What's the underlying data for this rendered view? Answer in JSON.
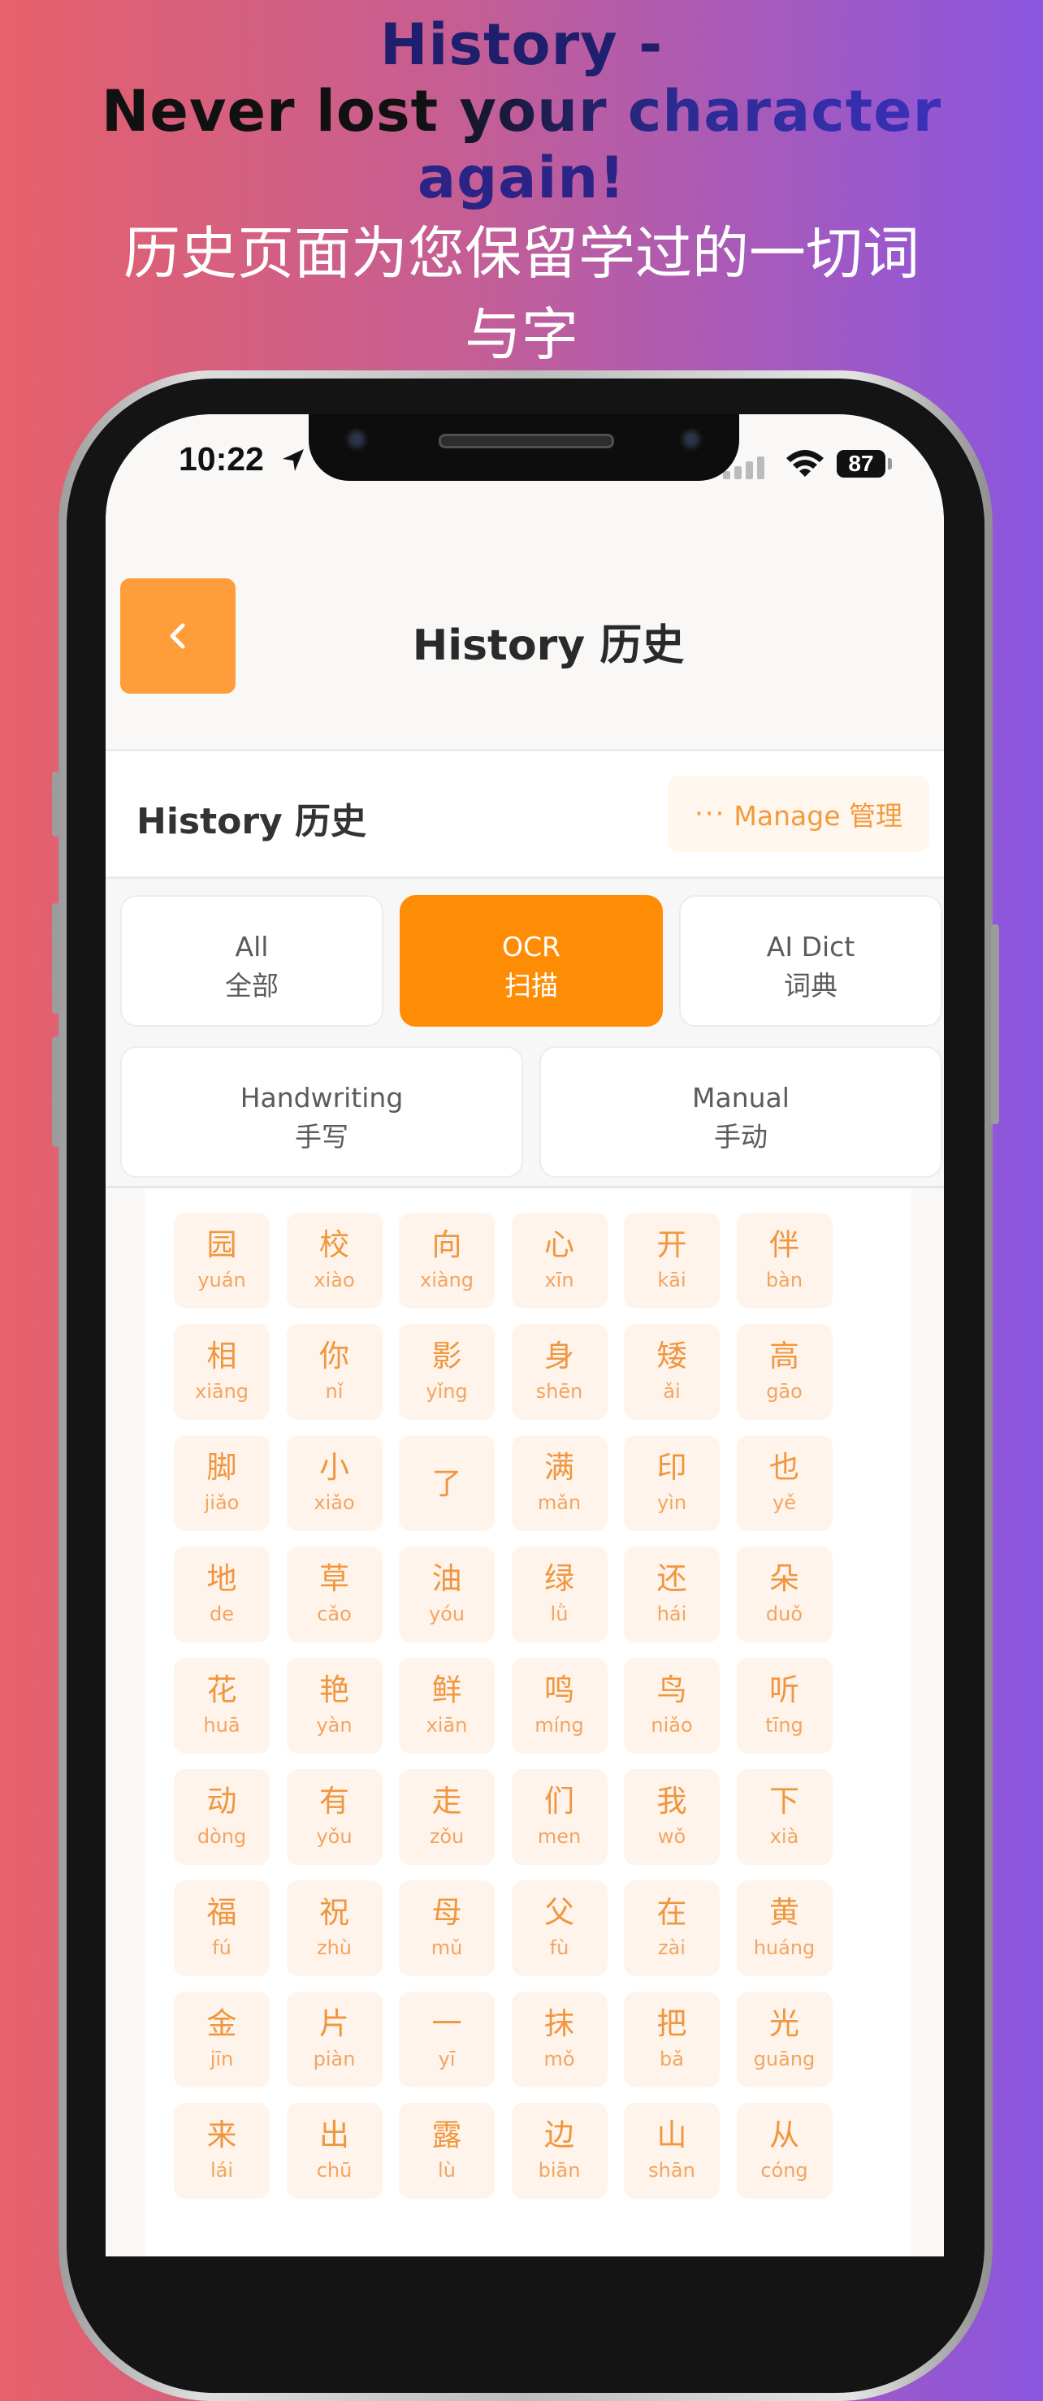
{
  "headline": {
    "line1": "History -",
    "line2": "Never lost your character",
    "line3": "again!",
    "subtitle": "历史页面为您保留学过的一切词与字"
  },
  "status_bar": {
    "time": "10:22",
    "battery": "87"
  },
  "nav": {
    "title": "History 历史",
    "back_icon": "chevron-left-icon"
  },
  "section": {
    "title": "History 历史",
    "manage_label": "Manage 管理",
    "manage_dots": "···"
  },
  "filters": [
    {
      "en": "All",
      "zh": "全部",
      "active": false
    },
    {
      "en": "OCR",
      "zh": "扫描",
      "active": true
    },
    {
      "en": "AI Dict",
      "zh": "词典",
      "active": false
    },
    {
      "en": "Handwriting",
      "zh": "手写",
      "active": false
    },
    {
      "en": "Manual",
      "zh": "手动",
      "active": false
    }
  ],
  "characters": [
    {
      "hz": "园",
      "py": "yuán"
    },
    {
      "hz": "校",
      "py": "xiào"
    },
    {
      "hz": "向",
      "py": "xiàng"
    },
    {
      "hz": "心",
      "py": "xīn"
    },
    {
      "hz": "开",
      "py": "kāi"
    },
    {
      "hz": "伴",
      "py": "bàn"
    },
    {
      "hz": "相",
      "py": "xiāng"
    },
    {
      "hz": "你",
      "py": "nǐ"
    },
    {
      "hz": "影",
      "py": "yǐng"
    },
    {
      "hz": "身",
      "py": "shēn"
    },
    {
      "hz": "矮",
      "py": "ǎi"
    },
    {
      "hz": "高",
      "py": "gāo"
    },
    {
      "hz": "脚",
      "py": "jiǎo"
    },
    {
      "hz": "小",
      "py": "xiǎo"
    },
    {
      "hz": "了",
      "py": ""
    },
    {
      "hz": "满",
      "py": "mǎn"
    },
    {
      "hz": "印",
      "py": "yìn"
    },
    {
      "hz": "也",
      "py": "yě"
    },
    {
      "hz": "地",
      "py": "de"
    },
    {
      "hz": "草",
      "py": "cǎo"
    },
    {
      "hz": "油",
      "py": "yóu"
    },
    {
      "hz": "绿",
      "py": "lǜ"
    },
    {
      "hz": "还",
      "py": "hái"
    },
    {
      "hz": "朵",
      "py": "duǒ"
    },
    {
      "hz": "花",
      "py": "huā"
    },
    {
      "hz": "艳",
      "py": "yàn"
    },
    {
      "hz": "鲜",
      "py": "xiān"
    },
    {
      "hz": "鸣",
      "py": "míng"
    },
    {
      "hz": "鸟",
      "py": "niǎo"
    },
    {
      "hz": "听",
      "py": "tīng"
    },
    {
      "hz": "动",
      "py": "dòng"
    },
    {
      "hz": "有",
      "py": "yǒu"
    },
    {
      "hz": "走",
      "py": "zǒu"
    },
    {
      "hz": "们",
      "py": "men"
    },
    {
      "hz": "我",
      "py": "wǒ"
    },
    {
      "hz": "下",
      "py": "xià"
    },
    {
      "hz": "福",
      "py": "fú"
    },
    {
      "hz": "祝",
      "py": "zhù"
    },
    {
      "hz": "母",
      "py": "mǔ"
    },
    {
      "hz": "父",
      "py": "fù"
    },
    {
      "hz": "在",
      "py": "zài"
    },
    {
      "hz": "黄",
      "py": "huáng"
    },
    {
      "hz": "金",
      "py": "jīn"
    },
    {
      "hz": "片",
      "py": "piàn"
    },
    {
      "hz": "一",
      "py": "yī"
    },
    {
      "hz": "抹",
      "py": "mǒ"
    },
    {
      "hz": "把",
      "py": "bǎ"
    },
    {
      "hz": "光",
      "py": "guāng"
    },
    {
      "hz": "来",
      "py": "lái"
    },
    {
      "hz": "出",
      "py": "chū"
    },
    {
      "hz": "露",
      "py": "lù"
    },
    {
      "hz": "边",
      "py": "biān"
    },
    {
      "hz": "山",
      "py": "shān"
    },
    {
      "hz": "从",
      "py": "cóng"
    }
  ],
  "colors": {
    "accent": "#ff8c05",
    "back_button": "#ff9d3a",
    "cell_bg": "#fff4eb",
    "cell_text": "#f0963e"
  }
}
